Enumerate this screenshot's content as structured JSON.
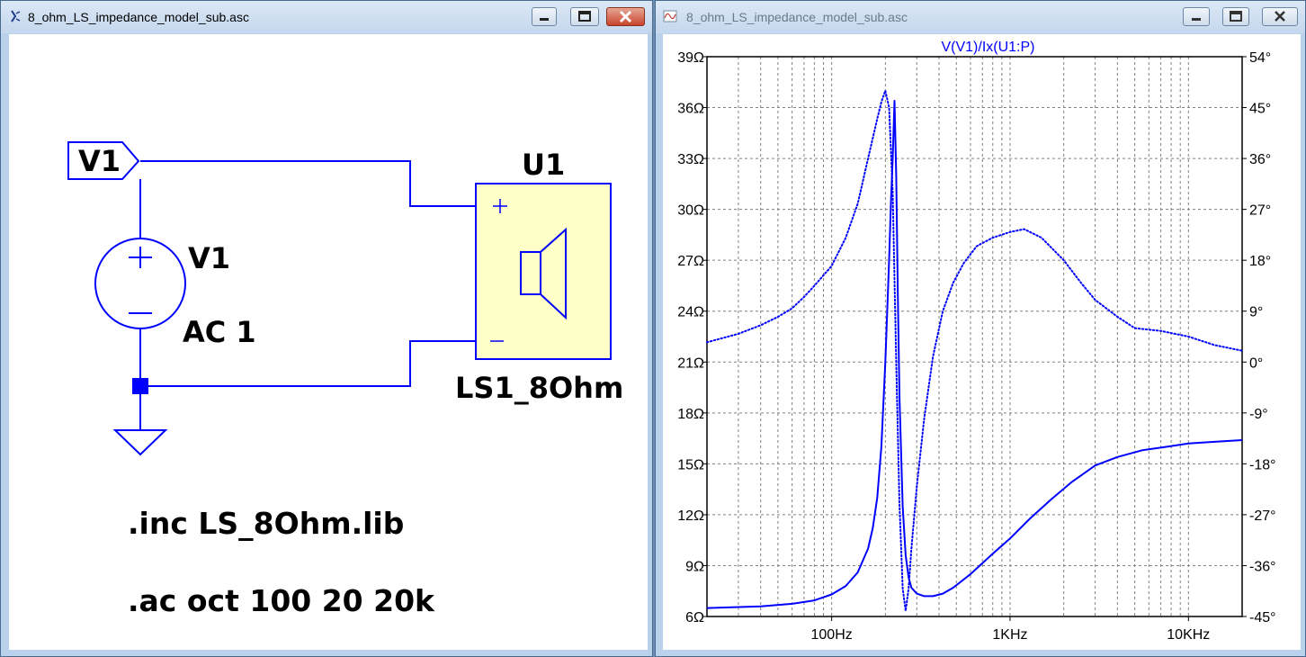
{
  "schematic_window": {
    "title": "8_ohm_LS_impedance_model_sub.asc",
    "app_icon": "ltspice-schematic-icon",
    "controls": [
      "minimize-icon",
      "maximize-icon",
      "close-icon"
    ],
    "net_label": "V1",
    "source": {
      "name": "V1",
      "value": "AC 1"
    },
    "component": {
      "ref": "U1",
      "value": "LS1_8Ohm",
      "icon": "speaker-icon"
    },
    "directives": [
      ".inc LS_8Ohm.lib",
      ".ac oct 100 20 20k"
    ],
    "colors": {
      "wire": "#0000ff",
      "component_fill": "#ffffc8"
    }
  },
  "waveform_window": {
    "title": "8_ohm_LS_impedance_model_sub.asc",
    "app_icon": "ltspice-waveform-icon",
    "controls": [
      "minimize-icon",
      "maximize-icon",
      "close-icon"
    ],
    "colors": {
      "trace": "#0000ff",
      "grid": "#808080"
    }
  },
  "chart_data": {
    "type": "line",
    "title": "V(V1)/Ix(U1:P)",
    "x_scale": "log",
    "xlim": [
      20,
      20000
    ],
    "x_ticks": [
      100,
      1000,
      10000
    ],
    "x_tick_labels": [
      "100Hz",
      "1KHz",
      "10KHz"
    ],
    "ylim_left": [
      6,
      39
    ],
    "y_ticks_left": [
      6,
      9,
      12,
      15,
      18,
      21,
      24,
      27,
      30,
      33,
      36,
      39
    ],
    "y_tick_labels_left": [
      "6Ω",
      "9Ω",
      "12Ω",
      "15Ω",
      "18Ω",
      "21Ω",
      "24Ω",
      "27Ω",
      "30Ω",
      "33Ω",
      "36Ω",
      "39Ω"
    ],
    "ylim_right": [
      -45,
      54
    ],
    "y_ticks_right": [
      -45,
      -36,
      -27,
      -18,
      -9,
      0,
      9,
      18,
      27,
      36,
      45,
      54
    ],
    "y_tick_labels_right": [
      "-45°",
      "-36°",
      "-27°",
      "-18°",
      "-9°",
      "0°",
      "9°",
      "18°",
      "27°",
      "36°",
      "45°",
      "54°"
    ],
    "grid": true,
    "series": [
      {
        "axis": "left",
        "style": "solid",
        "x": [
          20,
          40,
          60,
          80,
          100,
          120,
          140,
          160,
          170,
          180,
          190,
          200,
          210,
          215,
          220,
          225,
          230,
          235,
          240,
          250,
          260,
          270,
          280,
          300,
          330,
          370,
          420,
          480,
          600,
          800,
          1000,
          1300,
          1700,
          2200,
          3000,
          4000,
          5500,
          7500,
          10000,
          14000,
          20000
        ],
        "y": [
          6.5,
          6.6,
          6.75,
          6.95,
          7.3,
          7.8,
          8.6,
          10,
          11.2,
          13,
          16,
          21,
          27,
          30.5,
          33,
          36.4,
          32,
          25,
          19,
          12.5,
          9.6,
          8.3,
          7.7,
          7.35,
          7.2,
          7.2,
          7.35,
          7.7,
          8.5,
          9.7,
          10.6,
          11.8,
          12.9,
          13.9,
          14.9,
          15.4,
          15.8,
          16.0,
          16.2,
          16.3,
          16.4
        ]
      },
      {
        "axis": "right",
        "style": "dotted",
        "x": [
          20,
          30,
          40,
          50,
          60,
          70,
          80,
          100,
          120,
          140,
          160,
          180,
          190,
          200,
          210,
          220,
          230,
          240,
          250,
          260,
          270,
          280,
          300,
          330,
          370,
          420,
          480,
          550,
          650,
          800,
          1000,
          1200,
          1500,
          2000,
          2500,
          3000,
          4000,
          5000,
          7000,
          10000,
          14000,
          20000
        ],
        "y": [
          3.5,
          5,
          6.5,
          8,
          9.5,
          11.5,
          13.5,
          17,
          22,
          28,
          36,
          43,
          46,
          48,
          45,
          30,
          0,
          -25,
          -40,
          -44,
          -40,
          -33,
          -22,
          -10,
          1,
          9,
          14,
          17.5,
          20.5,
          22,
          23,
          23.5,
          22,
          18,
          14,
          11,
          8,
          6,
          5.5,
          4.5,
          3,
          2
        ]
      }
    ]
  }
}
